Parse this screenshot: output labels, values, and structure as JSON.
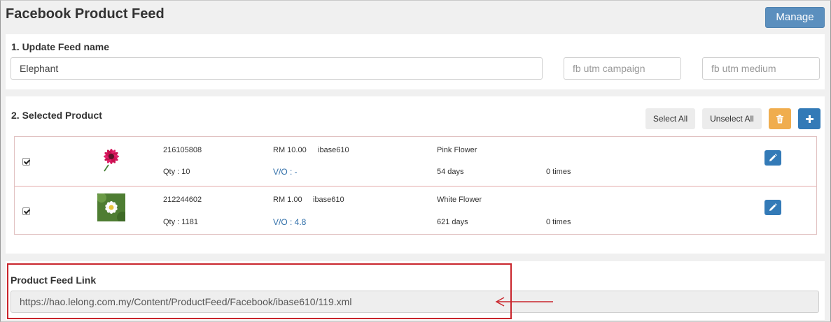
{
  "page": {
    "title": "Facebook Product Feed",
    "manage_label": "Manage"
  },
  "feed_name_section": {
    "label": "1. Update Feed name",
    "feed_name_value": "Elephant",
    "utm_campaign_placeholder": "fb utm campaign",
    "utm_medium_placeholder": "fb utm medium"
  },
  "selected_product": {
    "label": "2. Selected Product",
    "select_all_label": "Select All",
    "unselect_all_label": "Unselect All",
    "products": [
      {
        "checked": true,
        "image": "pink-flower",
        "id": "216105808",
        "qty": "Qty : 10",
        "price": "RM 10.00",
        "seller": "ibase610",
        "vo": "V/O : -",
        "name": "Pink Flower",
        "days": "54 days",
        "times": "0 times"
      },
      {
        "checked": true,
        "image": "white-flower",
        "id": "212244602",
        "qty": "Qty : 1181",
        "price": "RM 1.00",
        "seller": "ibase610",
        "vo": "V/O : 4.8",
        "name": "White Flower",
        "days": "621 days",
        "times": "0 times"
      }
    ]
  },
  "feed_link_section": {
    "label": "Product Feed Link",
    "url": "https://hao.lelong.com.my/Content/ProductFeed/Facebook/ibase610/119.xml"
  },
  "colors": {
    "manage_button": "#5b8fbe",
    "primary": "#337ab7",
    "warning": "#f0ad4e",
    "annotation": "#c9252c"
  },
  "icons": [
    "trash-icon",
    "plus-icon",
    "pencil-icon",
    "arrow-left-icon"
  ]
}
